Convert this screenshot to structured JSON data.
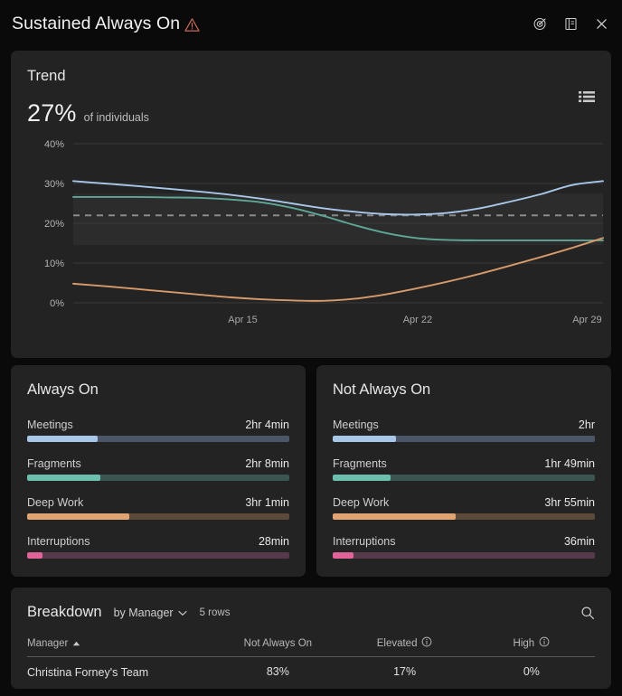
{
  "header": {
    "title": "Sustained Always On",
    "warning_icon": "warning-triangle-icon",
    "warning_color": "#c4695a",
    "actions": [
      {
        "name": "insights-target-icon",
        "glyph": "target-pin-icon"
      },
      {
        "name": "report-book-icon",
        "glyph": "book-icon"
      },
      {
        "name": "close-icon",
        "glyph": "close-icon"
      }
    ]
  },
  "trend": {
    "title": "Trend",
    "kpi_value": "27%",
    "kpi_subtitle": "of individuals",
    "legend_toggle_name": "legend-list-icon"
  },
  "chart_data": {
    "type": "line",
    "title": "Trend",
    "xlabel": "",
    "ylabel": "",
    "ylim": [
      0,
      40
    ],
    "yticks": [
      0,
      10,
      20,
      30,
      40
    ],
    "ytick_labels": [
      "0%",
      "10%",
      "20%",
      "30%",
      "40%"
    ],
    "xtick_labels": [
      "Apr 15",
      "Apr 22",
      "Apr 29"
    ],
    "xtick_positions": [
      0.32,
      0.65,
      0.97
    ],
    "grid": true,
    "legend_position": "hidden",
    "reference_line": {
      "value": 22,
      "style": "dashed",
      "color": "#8a8a8a"
    },
    "highlight_band": {
      "y_from": 14.5,
      "y_to": 27.5,
      "color": "#2c2c2c"
    },
    "x": [
      0,
      1,
      2,
      3,
      4,
      5,
      6,
      7,
      8,
      9,
      10,
      11,
      12,
      13,
      14
    ],
    "series": [
      {
        "name": "Always On",
        "color": "#a8c7e8",
        "values": [
          30.6,
          30.0,
          29.4,
          28.7,
          28.0,
          27.2,
          26.2,
          25.0,
          23.8,
          22.9,
          22.3,
          22.2,
          22.6,
          23.7,
          25.4,
          27.3,
          29.6,
          30.6
        ]
      },
      {
        "name": "Elevated",
        "color": "#5fa897",
        "values": [
          26.6,
          26.6,
          26.6,
          26.5,
          26.4,
          26.0,
          25.3,
          23.9,
          21.9,
          19.6,
          17.6,
          16.3,
          15.8,
          15.7,
          15.7,
          15.7,
          15.7,
          15.7
        ]
      },
      {
        "name": "High",
        "color": "#d79a6a",
        "values": [
          4.8,
          4.2,
          3.5,
          2.8,
          2.1,
          1.4,
          0.9,
          0.6,
          0.5,
          1.0,
          2.1,
          3.6,
          5.3,
          7.2,
          9.3,
          11.5,
          13.8,
          16.3
        ]
      }
    ]
  },
  "always_on": {
    "title": "Always On",
    "metrics": [
      {
        "label": "Meetings",
        "value": "2hr 4min",
        "fill_pct": 27,
        "fill_color": "#a8c7e8",
        "track_color": "#4b5768"
      },
      {
        "label": "Fragments",
        "value": "2hr 8min",
        "fill_pct": 28,
        "fill_color": "#6cbfad",
        "track_color": "#3b5550"
      },
      {
        "label": "Deep Work",
        "value": "3hr 1min",
        "fill_pct": 39,
        "fill_color": "#e0a472",
        "track_color": "#5b4a3a"
      },
      {
        "label": "Interruptions",
        "value": "28min",
        "fill_pct": 6,
        "fill_color": "#e0639a",
        "track_color": "#56394b"
      }
    ]
  },
  "not_always_on": {
    "title": "Not Always On",
    "metrics": [
      {
        "label": "Meetings",
        "value": "2hr",
        "fill_pct": 24,
        "fill_color": "#a8c7e8",
        "track_color": "#4b5768"
      },
      {
        "label": "Fragments",
        "value": "1hr 49min",
        "fill_pct": 22,
        "fill_color": "#6cbfad",
        "track_color": "#3b5550"
      },
      {
        "label": "Deep Work",
        "value": "3hr 55min",
        "fill_pct": 47,
        "fill_color": "#e0a472",
        "track_color": "#5b4a3a"
      },
      {
        "label": "Interruptions",
        "value": "36min",
        "fill_pct": 8,
        "fill_color": "#e0639a",
        "track_color": "#56394b"
      }
    ]
  },
  "breakdown": {
    "title": "Breakdown",
    "group_by_label": "by Manager",
    "row_count_label": "5 rows",
    "search_icon": "search-icon",
    "columns": [
      {
        "label": "Manager",
        "sorted": true,
        "sort_dir": "asc",
        "info": false
      },
      {
        "label": "Not Always On",
        "sorted": false,
        "info": false
      },
      {
        "label": "Elevated",
        "sorted": false,
        "info": true
      },
      {
        "label": "High",
        "sorted": false,
        "info": true
      }
    ],
    "rows": [
      {
        "manager": "Christina Forney's Team",
        "not_always_on": "83%",
        "elevated": "17%",
        "high": "0%"
      }
    ]
  }
}
